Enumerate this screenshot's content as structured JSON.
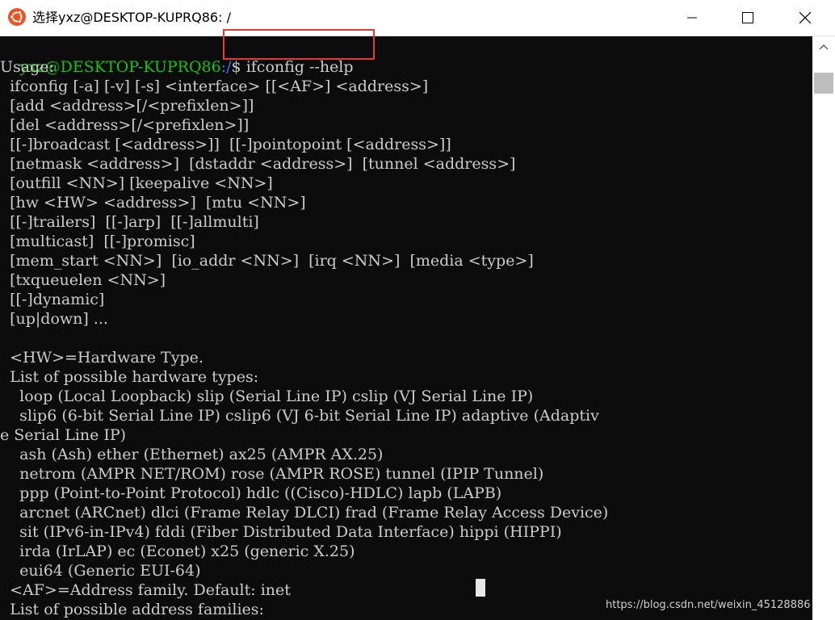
{
  "window": {
    "title": "选择yxz@DESKTOP-KUPRQ86: /",
    "icon": "ubuntu-icon",
    "accent_color": "#e95420",
    "minimize_icon": "minimize-icon",
    "maximize_icon": "maximize-icon",
    "close_icon": "close-icon"
  },
  "terminal": {
    "prompt_user": "yxz@DESKTOP-KUPRQ86",
    "prompt_path": ":/",
    "prompt_sign": "$ ",
    "command": "ifconfig --help",
    "output_lines": [
      "Usage:",
      "  ifconfig [-a] [-v] [-s] <interface> [[<AF>] <address>]",
      "  [add <address>[/<prefixlen>]]",
      "  [del <address>[/<prefixlen>]]",
      "  [[-]broadcast [<address>]]  [[-]pointopoint [<address>]]",
      "  [netmask <address>]  [dstaddr <address>]  [tunnel <address>]",
      "  [outfill <NN>] [keepalive <NN>]",
      "  [hw <HW> <address>]  [mtu <NN>]",
      "  [[-]trailers]  [[-]arp]  [[-]allmulti]",
      "  [multicast]  [[-]promisc]",
      "  [mem_start <NN>]  [io_addr <NN>]  [irq <NN>]  [media <type>]",
      "  [txqueuelen <NN>]",
      "  [[-]dynamic]",
      "  [up|down] ...",
      "",
      "  <HW>=Hardware Type.",
      "  List of possible hardware types:",
      "    loop (Local Loopback) slip (Serial Line IP) cslip (VJ Serial Line IP)",
      "    slip6 (6-bit Serial Line IP) cslip6 (VJ 6-bit Serial Line IP) adaptive (Adaptiv",
      "e Serial Line IP)",
      "    ash (Ash) ether (Ethernet) ax25 (AMPR AX.25)",
      "    netrom (AMPR NET/ROM) rose (AMPR ROSE) tunnel (IPIP Tunnel)",
      "    ppp (Point-to-Point Protocol) hdlc ((Cisco)-HDLC) lapb (LAPB)",
      "    arcnet (ARCnet) dlci (Frame Relay DLCI) frad (Frame Relay Access Device)",
      "    sit (IPv6-in-IPv4) fddi (Fiber Distributed Data Interface) hippi (HIPPI)",
      "    irda (IrLAP) ec (Econet) x25 (generic X.25)",
      "    eui64 (Generic EUI-64)",
      "  <AF>=Address family. Default: inet",
      "  List of possible address families:"
    ]
  },
  "watermark": "https://blog.csdn.net/weixin_45128886"
}
